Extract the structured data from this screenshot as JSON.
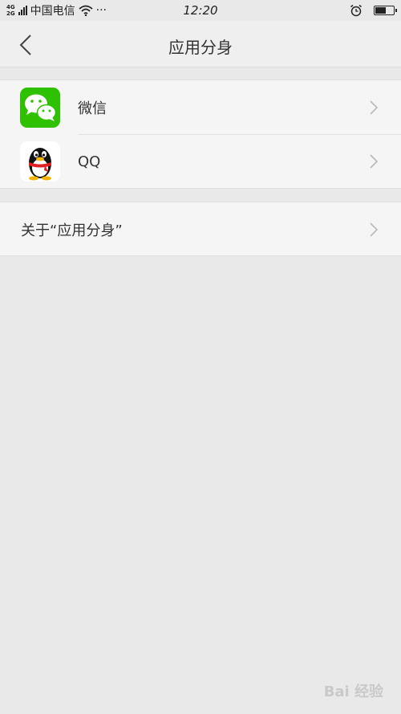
{
  "status_bar": {
    "network_top": "4G",
    "network_bottom": "2G",
    "carrier": "中国电信",
    "extra": "···",
    "time": "12:20",
    "battery_level": 0.6
  },
  "nav": {
    "title": "应用分身"
  },
  "apps": [
    {
      "label": "微信",
      "icon": "wechat-icon"
    },
    {
      "label": "QQ",
      "icon": "qq-penguin-icon"
    }
  ],
  "about": {
    "label": "关于“应用分身”"
  },
  "watermark": "Bai 经验",
  "colors": {
    "wechat_green": "#2dc100",
    "background": "#e9e9e9"
  }
}
